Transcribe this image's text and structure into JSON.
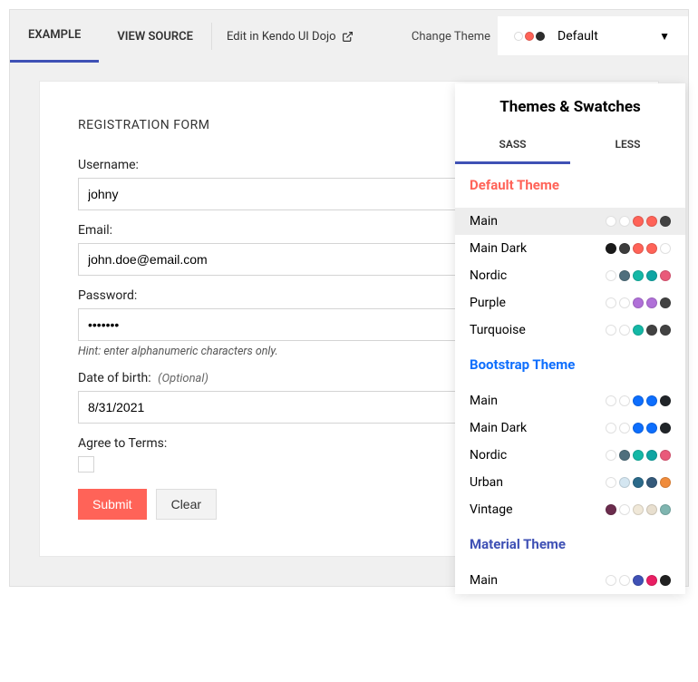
{
  "tabs": {
    "example": "EXAMPLE",
    "view_source": "VIEW SOURCE",
    "edit_dojo": "Edit in Kendo UI Dojo"
  },
  "change_theme_label": "Change Theme",
  "theme_selector": {
    "label": "Default",
    "swatches": [
      "#ffffff",
      "#ff6358",
      "#2d2d2d"
    ]
  },
  "form": {
    "title": "REGISTRATION FORM",
    "username_label": "Username:",
    "username_value": "johny",
    "email_label": "Email:",
    "email_value": "john.doe@email.com",
    "password_label": "Password:",
    "password_value": "•••••••",
    "password_hint": "Hint: enter alphanumeric characters only.",
    "dob_label": "Date of birth:",
    "dob_optional": "(Optional)",
    "dob_value": "8/31/2021",
    "agree_label": "Agree to Terms:",
    "submit": "Submit",
    "clear": "Clear"
  },
  "popup": {
    "title": "Themes & Swatches",
    "tab_sass": "SASS",
    "tab_less": "LESS",
    "groups": [
      {
        "title": "Default Theme",
        "title_color": "#ff6358",
        "items": [
          {
            "name": "Main",
            "selected": true,
            "swatches": [
              "#ffffff",
              "#ffffff",
              "#ff6358",
              "#ff6358",
              "#424242"
            ]
          },
          {
            "name": "Main Dark",
            "swatches": [
              "#1a1a1a",
              "#3d3d3d",
              "#ff6358",
              "#ff6358",
              "#ffffff"
            ]
          },
          {
            "name": "Nordic",
            "swatches": [
              "#ffffff",
              "#4f6f7d",
              "#14b8a6",
              "#0ea5a3",
              "#e95a7a"
            ]
          },
          {
            "name": "Purple",
            "swatches": [
              "#ffffff",
              "#ffffff",
              "#b070d8",
              "#b070d8",
              "#424242"
            ]
          },
          {
            "name": "Turquoise",
            "swatches": [
              "#ffffff",
              "#ffffff",
              "#14b8a6",
              "#424242",
              "#424242"
            ]
          }
        ]
      },
      {
        "title": "Bootstrap Theme",
        "title_color": "#0d6efd",
        "items": [
          {
            "name": "Main",
            "swatches": [
              "#ffffff",
              "#ffffff",
              "#0d6efd",
              "#0d6efd",
              "#212529"
            ]
          },
          {
            "name": "Main Dark",
            "swatches": [
              "#ffffff",
              "#ffffff",
              "#0d6efd",
              "#0d6efd",
              "#212529"
            ]
          },
          {
            "name": "Nordic",
            "swatches": [
              "#ffffff",
              "#4f6f7d",
              "#14b8a6",
              "#0ea5a3",
              "#e95a7a"
            ]
          },
          {
            "name": "Urban",
            "swatches": [
              "#ffffff",
              "#d4e6f1",
              "#2b6a8a",
              "#34597a",
              "#f08c3c"
            ]
          },
          {
            "name": "Vintage",
            "swatches": [
              "#6b2c4d",
              "#ffffff",
              "#f0e8d8",
              "#e8dfcf",
              "#7fb5b0"
            ]
          }
        ]
      },
      {
        "title": "Material Theme",
        "title_color": "#3f51b5",
        "items": [
          {
            "name": "Main",
            "swatches": [
              "#ffffff",
              "#ffffff",
              "#3f51b5",
              "#e91e63",
              "#212121"
            ]
          }
        ]
      }
    ]
  }
}
